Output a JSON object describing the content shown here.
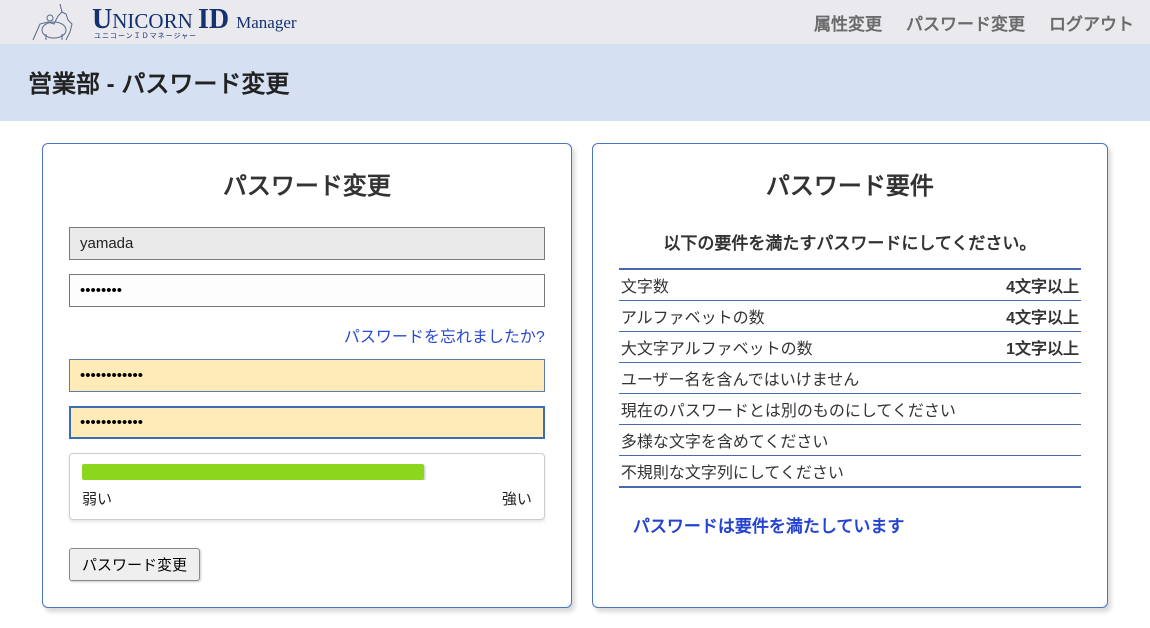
{
  "logo": {
    "text_prefix": "U",
    "text_mid": "NICORN ",
    "text_big": "ID ",
    "text_small": "Manager",
    "subtitle": "ユニコーンＩＤマネージャー"
  },
  "nav": {
    "attr": "属性変更",
    "pw": "パスワード変更",
    "logout": "ログアウト"
  },
  "subheader": "営業部 - パスワード変更",
  "form": {
    "title": "パスワード変更",
    "username": "yamada",
    "current_pw": "••••••••",
    "forgot": "パスワードを忘れましたか?",
    "new_pw": "••••••••••••",
    "confirm_pw": "••••••••••••",
    "strength_weak": "弱い",
    "strength_strong": "強い",
    "strength_percent": 76,
    "submit": "パスワード変更"
  },
  "requirements": {
    "title": "パスワード要件",
    "intro": "以下の要件を満たすパスワードにしてください。",
    "rows": [
      {
        "label": "文字数",
        "value": "4文字以上"
      },
      {
        "label": "アルファベットの数",
        "value": "4文字以上"
      },
      {
        "label": "大文字アルファベットの数",
        "value": "1文字以上"
      },
      {
        "label": "ユーザー名を含んではいけません",
        "value": ""
      },
      {
        "label": "現在のパスワードとは別のものにしてください",
        "value": ""
      },
      {
        "label": "多様な文字を含めてください",
        "value": ""
      },
      {
        "label": "不規則な文字列にしてください",
        "value": ""
      }
    ],
    "status": "パスワードは要件を満たしています"
  }
}
